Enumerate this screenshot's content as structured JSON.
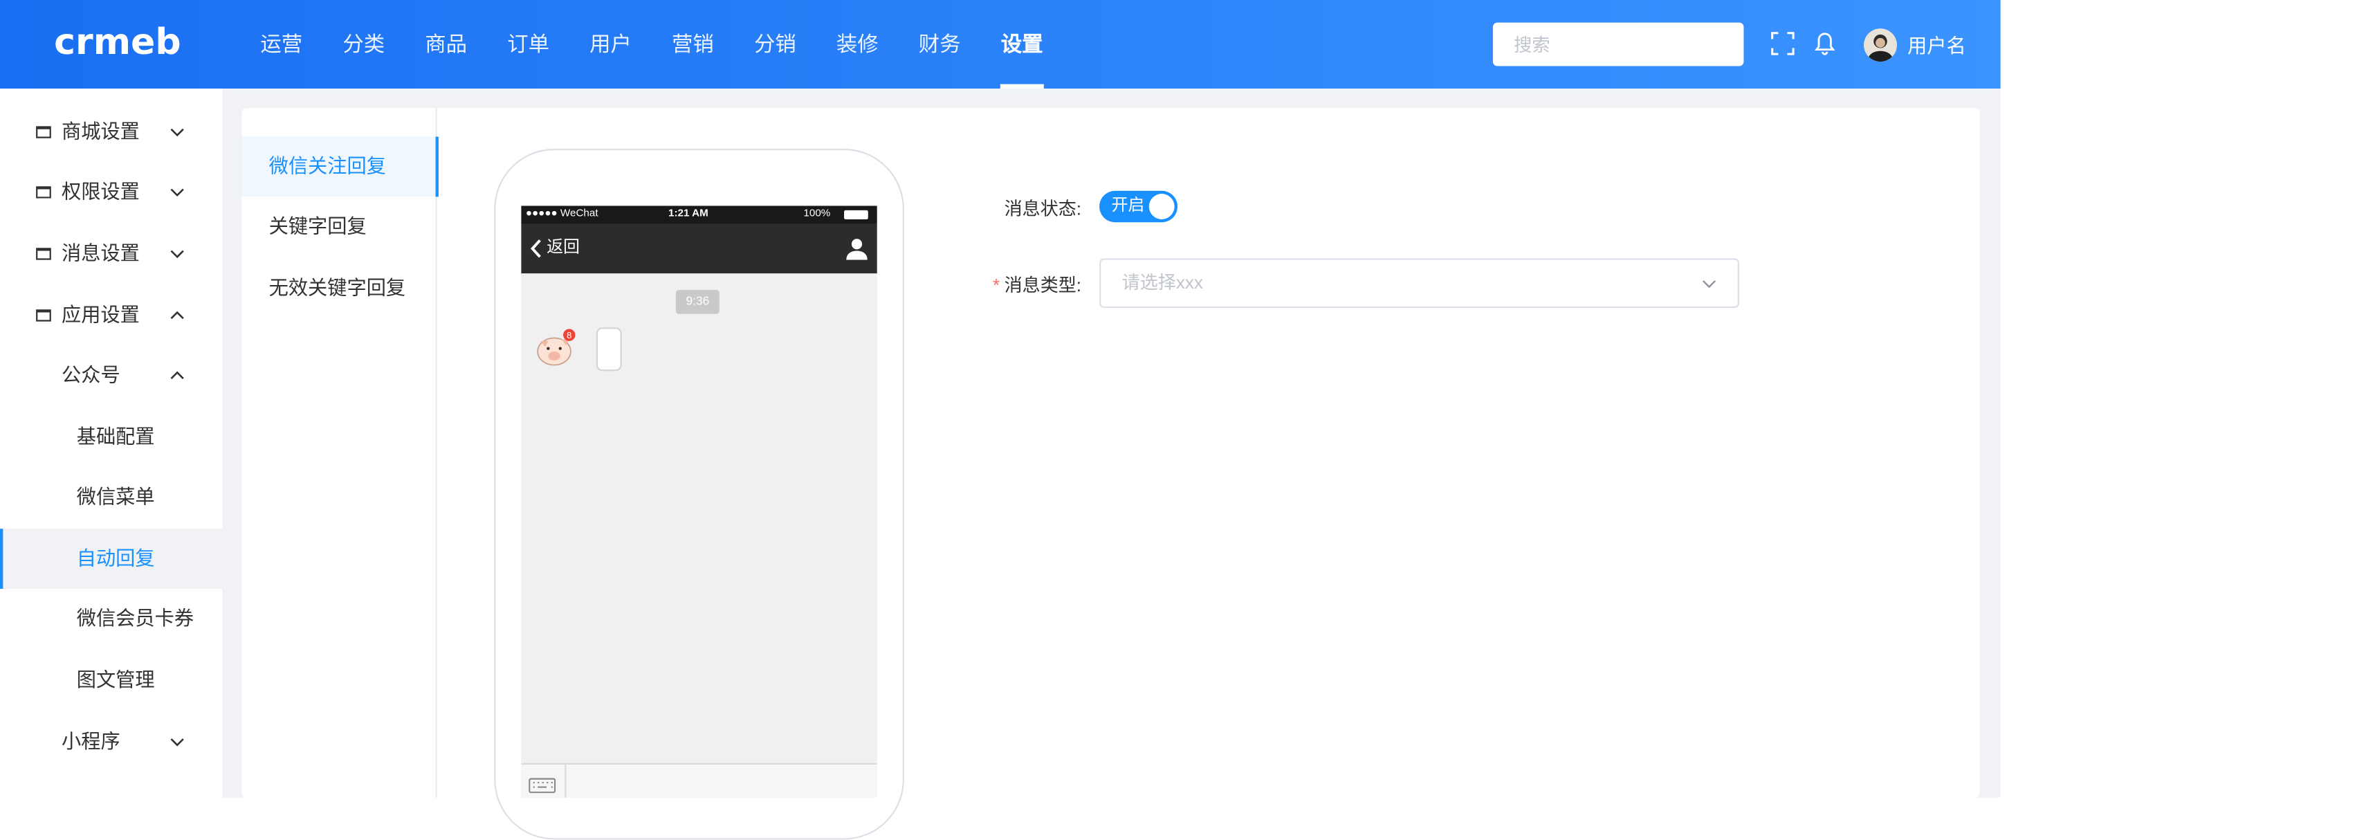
{
  "header": {
    "logo": "crmeb",
    "nav": [
      "运营",
      "分类",
      "商品",
      "订单",
      "用户",
      "营销",
      "分销",
      "装修",
      "财务",
      "设置"
    ],
    "active_nav": "设置",
    "search_placeholder": "搜索",
    "username": "用户名",
    "icons": [
      "fullscreen-icon",
      "bell-icon",
      "user-avatar"
    ]
  },
  "sidebar": {
    "items": [
      {
        "label": "商城设置",
        "level": 0,
        "icon": "square-icon",
        "expanded": false
      },
      {
        "label": "权限设置",
        "level": 0,
        "icon": "square-icon",
        "expanded": false
      },
      {
        "label": "消息设置",
        "level": 0,
        "icon": "square-icon",
        "expanded": false
      },
      {
        "label": "应用设置",
        "level": 0,
        "icon": "square-icon",
        "expanded": true
      },
      {
        "label": "公众号",
        "level": 1,
        "expanded": true
      },
      {
        "label": "基础配置",
        "level": 2
      },
      {
        "label": "微信菜单",
        "level": 2
      },
      {
        "label": "自动回复",
        "level": 2,
        "active": true
      },
      {
        "label": "微信会员卡券",
        "level": 2
      },
      {
        "label": "图文管理",
        "level": 2
      },
      {
        "label": "小程序",
        "level": 1,
        "expanded": false
      }
    ]
  },
  "subnav": {
    "items": [
      "微信关注回复",
      "关键字回复",
      "无效关键字回复"
    ],
    "active": "微信关注回复"
  },
  "phone": {
    "carrier": "●●●●● WeChat",
    "clock": "1:21 AM",
    "battery": "100%",
    "back_label": "返回",
    "timestamp": "9:36",
    "badge": "8"
  },
  "form": {
    "status_label": "消息状态:",
    "status_switch_text": "开启",
    "status_on": true,
    "type_label": "消息类型:",
    "type_placeholder": "请选择xxx",
    "type_required": true
  },
  "colors": {
    "primary": "#1890ff",
    "header_start": "#1a6ff2",
    "header_end": "#3b94ff",
    "page_bg": "#f0f2f5"
  }
}
